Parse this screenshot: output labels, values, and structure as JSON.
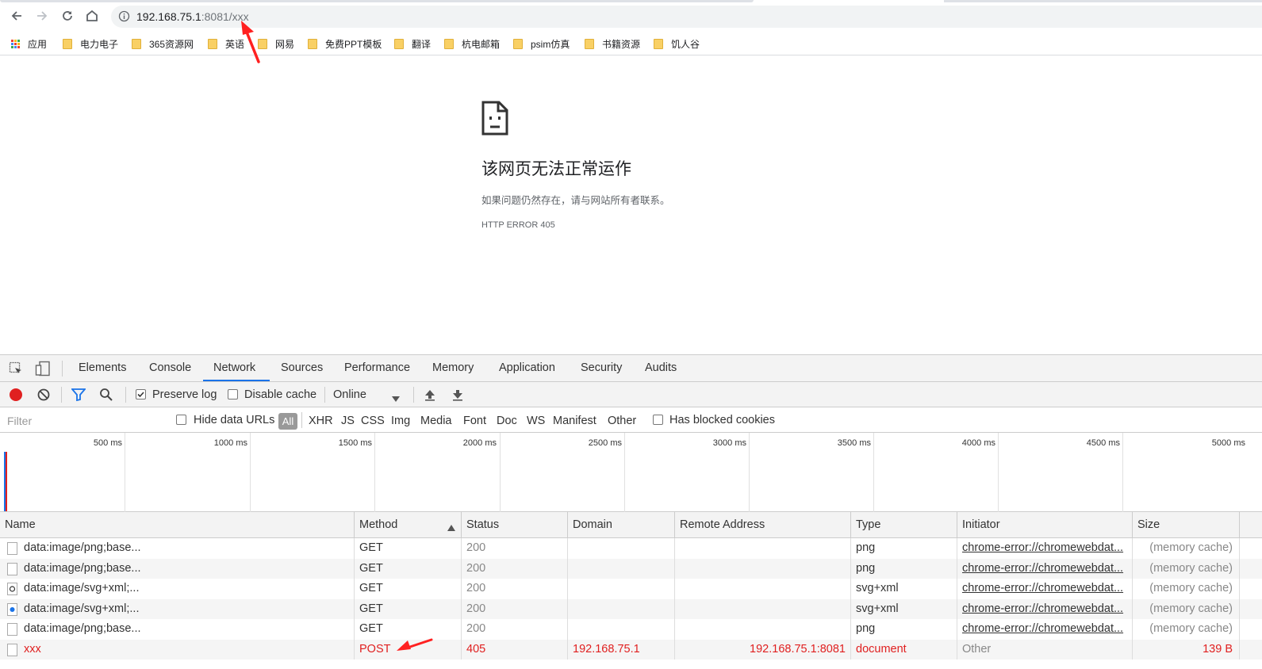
{
  "browser": {
    "url_host": "192.168.75.1",
    "url_rest": ":8081/xxx",
    "bookmarks": [
      "应用",
      "电力电子",
      "365资源网",
      "英语",
      "网易",
      "免费PPT模板",
      "翻译",
      "杭电邮箱",
      "psim仿真",
      "书籍资源",
      "饥人谷"
    ]
  },
  "error_page": {
    "title": "该网页无法正常运作",
    "subtitle": "如果问题仍然存在，请与网站所有者联系。",
    "code": "HTTP ERROR 405"
  },
  "devtools": {
    "tabs": [
      "Elements",
      "Console",
      "Network",
      "Sources",
      "Performance",
      "Memory",
      "Application",
      "Security",
      "Audits"
    ],
    "active_tab": "Network",
    "toolbar": {
      "preserve_log": "Preserve log",
      "preserve_log_checked": true,
      "disable_cache": "Disable cache",
      "disable_cache_checked": false,
      "throttle": "Online"
    },
    "filter": {
      "placeholder": "Filter",
      "hide_data_urls": "Hide data URLs",
      "types": [
        "All",
        "XHR",
        "JS",
        "CSS",
        "Img",
        "Media",
        "Font",
        "Doc",
        "WS",
        "Manifest",
        "Other"
      ],
      "active_type": "All",
      "has_blocked_cookies": "Has blocked cookies"
    },
    "timeline_ticks": [
      "500 ms",
      "1000 ms",
      "1500 ms",
      "2000 ms",
      "2500 ms",
      "3000 ms",
      "3500 ms",
      "4000 ms",
      "4500 ms",
      "5000 ms"
    ],
    "columns": [
      "Name",
      "Method",
      "Status",
      "Domain",
      "Remote Address",
      "Type",
      "Initiator",
      "Size"
    ],
    "rows": [
      {
        "name": "data:image/png;base...",
        "method": "GET",
        "status": "200",
        "domain": "",
        "remote": "",
        "type": "png",
        "initiator": "chrome-error://chromewebdat...",
        "size": "(memory cache)"
      },
      {
        "name": "data:image/png;base...",
        "method": "GET",
        "status": "200",
        "domain": "",
        "remote": "",
        "type": "png",
        "initiator": "chrome-error://chromewebdat...",
        "size": "(memory cache)"
      },
      {
        "name": "data:image/svg+xml;...",
        "method": "GET",
        "status": "200",
        "domain": "",
        "remote": "",
        "type": "svg+xml",
        "initiator": "chrome-error://chromewebdat...",
        "size": "(memory cache)"
      },
      {
        "name": "data:image/svg+xml;...",
        "method": "GET",
        "status": "200",
        "domain": "",
        "remote": "",
        "type": "svg+xml",
        "initiator": "chrome-error://chromewebdat...",
        "size": "(memory cache)"
      },
      {
        "name": "data:image/png;base...",
        "method": "GET",
        "status": "200",
        "domain": "",
        "remote": "",
        "type": "png",
        "initiator": "chrome-error://chromewebdat...",
        "size": "(memory cache)"
      },
      {
        "name": "xxx",
        "method": "POST",
        "status": "405",
        "domain": "192.168.75.1",
        "remote": "192.168.75.1:8081",
        "type": "document",
        "initiator": "Other",
        "size": "139 B"
      }
    ]
  },
  "colors": {
    "accent": "#1a73e8",
    "error": "#e02020",
    "record": "#e02020",
    "annotation_arrow": "#ff2020"
  }
}
